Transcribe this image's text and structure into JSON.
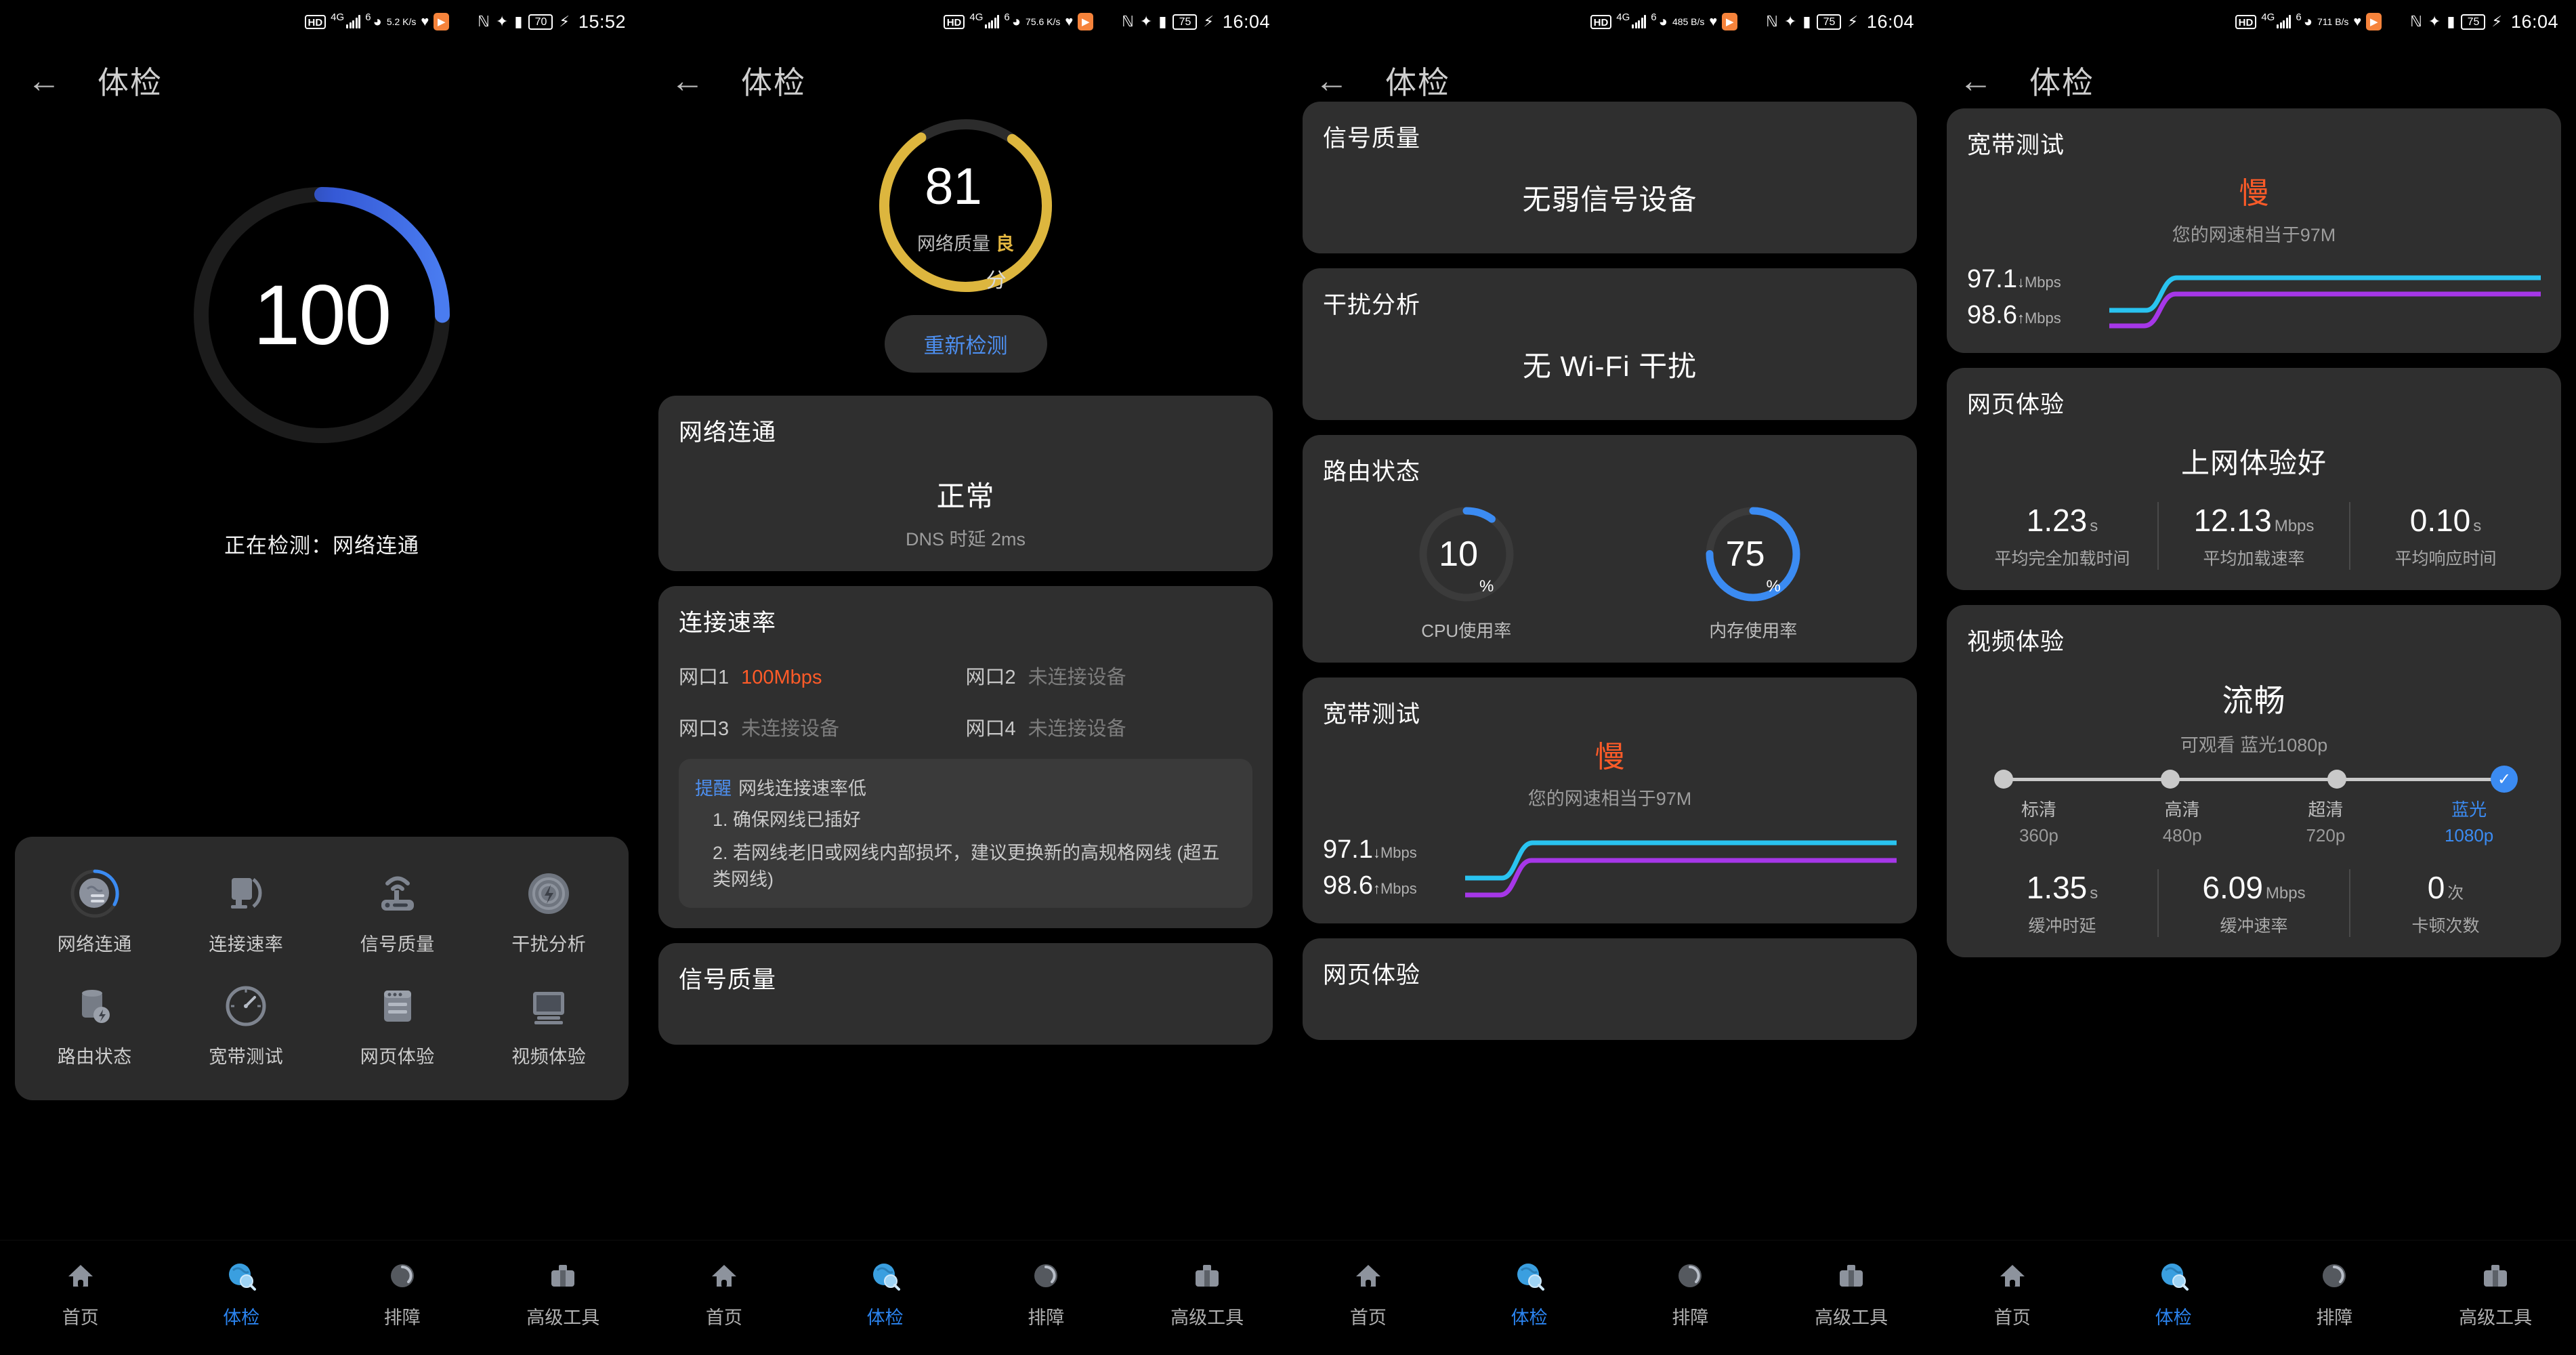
{
  "statusbars": [
    {
      "hd": "HD",
      "net": "4G",
      "wifi": "6",
      "speed": "5.2 K/s",
      "battery": "70",
      "time": "15:52"
    },
    {
      "hd": "HD",
      "net": "4G",
      "wifi": "6",
      "speed": "75.6 K/s",
      "battery": "75",
      "time": "16:04"
    },
    {
      "hd": "HD",
      "net": "4G",
      "wifi": "6",
      "speed": "485 B/s",
      "battery": "75",
      "time": "16:04"
    },
    {
      "hd": "HD",
      "net": "4G",
      "wifi": "6",
      "speed": "711 B/s",
      "battery": "75",
      "time": "16:04"
    }
  ],
  "title": "体检",
  "panel1": {
    "score": "100",
    "status_text": "正在检测：网络连通",
    "grid": [
      {
        "label": "网络连通",
        "icon": "globe-connection-icon",
        "active": true
      },
      {
        "label": "连接速率",
        "icon": "ethernet-port-icon",
        "active": false
      },
      {
        "label": "信号质量",
        "icon": "router-signal-icon",
        "active": false
      },
      {
        "label": "干扰分析",
        "icon": "interference-radar-icon",
        "active": false
      },
      {
        "label": "路由状态",
        "icon": "server-status-icon",
        "active": false
      },
      {
        "label": "宽带测试",
        "icon": "speedometer-icon",
        "active": false
      },
      {
        "label": "网页体验",
        "icon": "browser-window-icon",
        "active": false
      },
      {
        "label": "视频体验",
        "icon": "monitor-icon",
        "active": false
      }
    ]
  },
  "panel2": {
    "score": "81",
    "score_unit": "分",
    "quality_label": "网络质量",
    "quality_value": "良",
    "retest_button": "重新检测",
    "card_connectivity": {
      "title": "网络连通",
      "value": "正常",
      "sub": "DNS 时延 2ms"
    },
    "card_speed": {
      "title": "连接速率",
      "ports": [
        {
          "name": "网口1",
          "value": "100Mbps",
          "hot": true
        },
        {
          "name": "网口2",
          "value": "未连接设备",
          "hot": false
        },
        {
          "name": "网口3",
          "value": "未连接设备",
          "hot": false
        },
        {
          "name": "网口4",
          "value": "未连接设备",
          "hot": false
        }
      ],
      "tip_label": "提醒",
      "tip_title": "网线连接速率低",
      "tip_lines": [
        "1. 确保网线已插好",
        "2. 若网线老旧或网线内部损坏，建议更换新的高规格网线 (超五类网线)"
      ]
    },
    "card_signal": {
      "title": "信号质量"
    }
  },
  "panel3": {
    "card_signal": {
      "title": "信号质量",
      "value": "无弱信号设备"
    },
    "card_interference": {
      "title": "干扰分析",
      "value": "无 Wi-Fi 干扰"
    },
    "card_router": {
      "title": "路由状态",
      "gauges": [
        {
          "value": "10",
          "unit": "%",
          "label": "CPU使用率",
          "pct": 10
        },
        {
          "value": "75",
          "unit": "%",
          "label": "内存使用率",
          "pct": 75
        }
      ]
    },
    "card_broadband": {
      "title": "宽带测试",
      "status": "慢",
      "sub": "您的网速相当于97M",
      "down": {
        "value": "97.1",
        "arrow": "↓",
        "unit": "Mbps"
      },
      "up": {
        "value": "98.6",
        "arrow": "↑",
        "unit": "Mbps"
      }
    },
    "card_web": {
      "title": "网页体验"
    }
  },
  "panel4": {
    "card_broadband": {
      "title": "宽带测试",
      "status": "慢",
      "sub": "您的网速相当于97M",
      "down": {
        "value": "97.1",
        "arrow": "↓",
        "unit": "Mbps"
      },
      "up": {
        "value": "98.6",
        "arrow": "↑",
        "unit": "Mbps"
      }
    },
    "card_web": {
      "title": "网页体验",
      "value": "上网体验好",
      "metrics": [
        {
          "value": "1.23",
          "unit": "s",
          "label": "平均完全加载时间"
        },
        {
          "value": "12.13",
          "unit": "Mbps",
          "label": "平均加载速率"
        },
        {
          "value": "0.10",
          "unit": "s",
          "label": "平均响应时间"
        }
      ]
    },
    "card_video": {
      "title": "视频体验",
      "value": "流畅",
      "sub": "可观看 蓝光1080p",
      "levels": [
        {
          "name": "标清",
          "res": "360p",
          "selected": false
        },
        {
          "name": "高清",
          "res": "480p",
          "selected": false
        },
        {
          "name": "超清",
          "res": "720p",
          "selected": false
        },
        {
          "name": "蓝光",
          "res": "1080p",
          "selected": true
        }
      ],
      "metrics": [
        {
          "value": "1.35",
          "unit": "s",
          "label": "缓冲时延"
        },
        {
          "value": "6.09",
          "unit": "Mbps",
          "label": "缓冲速率"
        },
        {
          "value": "0",
          "unit": "次",
          "label": "卡顿次数"
        }
      ]
    }
  },
  "bottomnav": [
    {
      "label": "首页",
      "icon": "home-icon",
      "active": false
    },
    {
      "label": "体检",
      "icon": "checkup-globe-icon",
      "active": true
    },
    {
      "label": "排障",
      "icon": "troubleshoot-gauge-icon",
      "active": false
    },
    {
      "label": "高级工具",
      "icon": "toolbox-icon",
      "active": false
    }
  ],
  "colors": {
    "accent_blue": "#2b84f0",
    "warn_orange": "#FF5B28",
    "gold": "#E3B640",
    "download_cyan": "#29C3F0",
    "upload_purple": "#A637E8"
  }
}
